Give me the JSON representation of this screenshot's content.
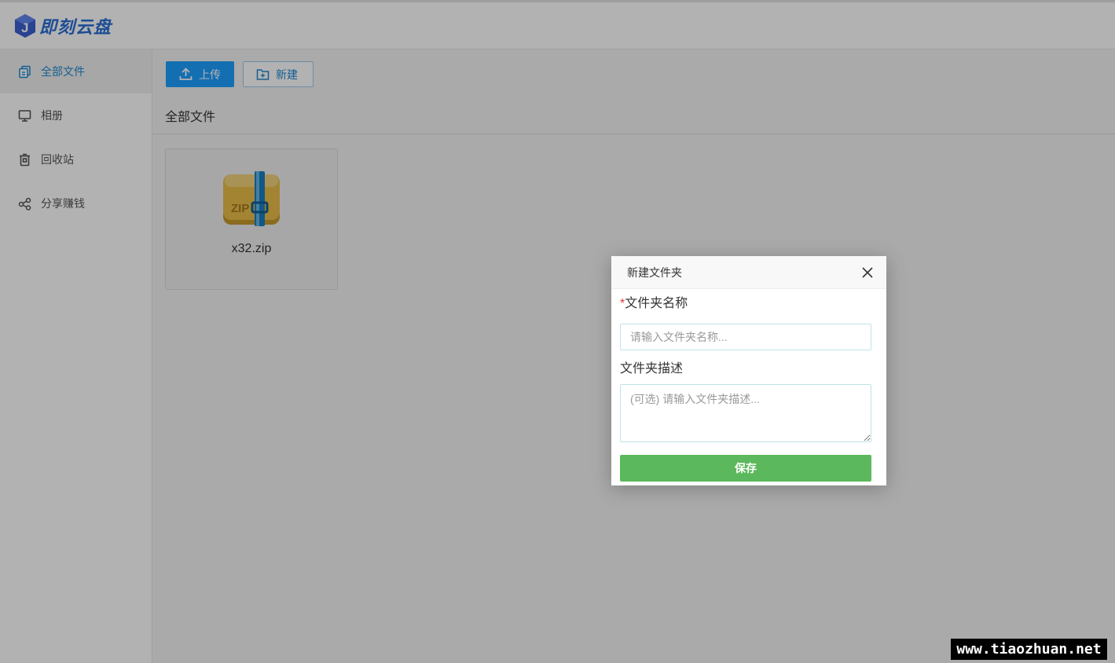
{
  "app": {
    "logo_text": "即刻云盘"
  },
  "sidebar": {
    "items": [
      {
        "label": "全部文件",
        "icon": "files-icon",
        "active": true
      },
      {
        "label": "相册",
        "icon": "monitor-icon"
      },
      {
        "label": "回收站",
        "icon": "trash-icon"
      },
      {
        "label": "分享赚钱",
        "icon": "share-icon"
      }
    ]
  },
  "toolbar": {
    "upload_label": "上传",
    "new_label": "新建"
  },
  "breadcrumb": "全部文件",
  "files": [
    {
      "name": "x32.zip",
      "icon": "zip-archive-icon"
    }
  ],
  "dialog": {
    "title": "新建文件夹",
    "name_required_mark": "*",
    "name_label": "文件夹名称",
    "name_placeholder": "请输入文件夹名称...",
    "desc_label": "文件夹描述",
    "desc_placeholder": "(可选) 请输入文件夹描述...",
    "save_label": "保存"
  },
  "watermark": "www.tiaozhuan.net",
  "colors": {
    "accent": "#1e9fff",
    "save": "#5cb85c",
    "active_text": "#1e88d2"
  }
}
